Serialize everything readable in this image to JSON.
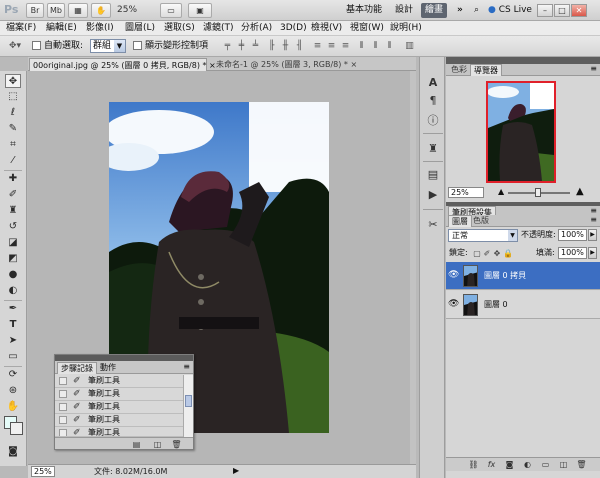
{
  "titlebar": {
    "app_logo": "Ps",
    "bridge_label": "Br",
    "minibridge_label": "Mb",
    "zoom": "25%",
    "workspace_basic": "基本功能",
    "workspace_design": "設計",
    "workspace_paint": "繪畫",
    "more": "»",
    "cslive": "CS Live",
    "minimize": "–",
    "restore": "□",
    "close": "✕"
  },
  "menu": {
    "items": [
      "檔案(F)",
      "編輯(E)",
      "影像(I)",
      "圖層(L)",
      "選取(S)",
      "濾鏡(T)",
      "分析(A)",
      "3D(D)",
      "檢視(V)",
      "視窗(W)",
      "說明(H)"
    ]
  },
  "options": {
    "auto_select_label": "自動選取:",
    "auto_select_value": "群組",
    "show_transform_label": "顯示變形控制項"
  },
  "document": {
    "tabs": [
      "00original.jpg @ 25% (圖層 0 拷貝, RGB/8) *",
      "未命名-1 @ 25% (圖層 3, RGB/8) *"
    ],
    "tab_close": "×",
    "zoom": "25%",
    "file_info": "文件: 8.02M/16.0M"
  },
  "history_panel": {
    "tabs": [
      "步驟記錄",
      "動作"
    ],
    "rows": [
      "筆刷工具",
      "筆刷工具",
      "筆刷工具",
      "筆刷工具",
      "筆刷工具"
    ]
  },
  "navigator": {
    "tabs": [
      "色彩",
      "導覽器"
    ],
    "zoom": "25%"
  },
  "brush_presets": {
    "tab": "筆刷預設集"
  },
  "layers_panel": {
    "tabs": [
      "圖層",
      "色版"
    ],
    "blend_mode": "正常",
    "opacity_label": "不透明度:",
    "opacity_value": "100%",
    "lock_label": "鎖定:",
    "fill_label": "填滿:",
    "fill_value": "100%",
    "layers": [
      {
        "name": "圖層 0 拷貝",
        "selected": true
      },
      {
        "name": "圖層 0",
        "selected": false
      }
    ]
  }
}
